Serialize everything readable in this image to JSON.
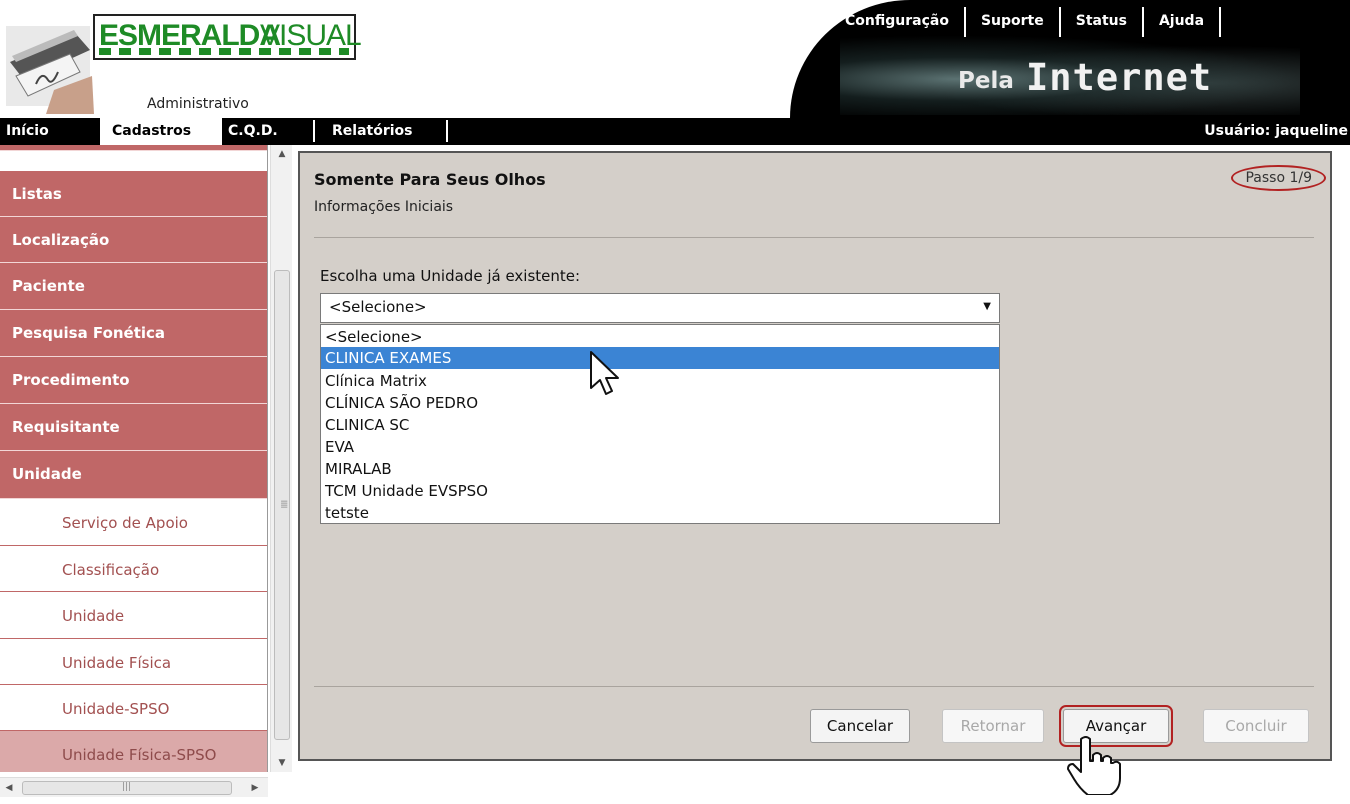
{
  "header": {
    "logo_word1": "ESMERALDA",
    "logo_word2": "VISUAL",
    "logo_subtitle": "Administrativo",
    "banner_pela": "Pela",
    "banner_internet": "Internet",
    "top_menu": [
      "Configuração",
      "Suporte",
      "Status",
      "Ajuda"
    ]
  },
  "nav": {
    "items": [
      "Início",
      "Cadastros",
      "C.Q.D.",
      "Relatórios"
    ],
    "active": "Cadastros",
    "user": "Usuário: jaqueline"
  },
  "sidebar": {
    "items": [
      "Listas",
      "Localização",
      "Paciente",
      "Pesquisa Fonética",
      "Procedimento",
      "Requisitante",
      "Unidade"
    ],
    "subitems": [
      "Serviço de Apoio",
      "Classificação",
      "Unidade",
      "Unidade Física",
      "Unidade-SPSO",
      "Unidade Física-SPSO"
    ],
    "selected_subitem": "Unidade Física-SPSO",
    "scroll_down_icon": "chevron-down-icon",
    "scroll_up_icon": "chevron-up-icon"
  },
  "wizard": {
    "title": "Somente Para Seus Olhos",
    "subtitle": "Informações Iniciais",
    "step": "Passo 1/9",
    "prompt": "Escolha uma Unidade já existente:",
    "select_value": "<Selecione>",
    "options": [
      "<Selecione>",
      "CLINICA EXAMES",
      "Clínica Matrix",
      "CLÍNICA SÃO PEDRO",
      "CLINICA SC",
      "EVA",
      "MIRALAB",
      "TCM Unidade EVSPSO",
      "tetste"
    ],
    "highlighted_option": "CLINICA EXAMES",
    "buttons": {
      "cancel": "Cancelar",
      "back": "Retornar",
      "next": "Avançar",
      "finish": "Concluir"
    }
  },
  "colors": {
    "sidebar_item": "#c06767",
    "sidebar_sub_text": "#a25050",
    "panel_bg": "#d4cfc9",
    "highlight": "#3b84d4",
    "logo_green": "#1e8b26",
    "annotation_red": "#b22222"
  }
}
